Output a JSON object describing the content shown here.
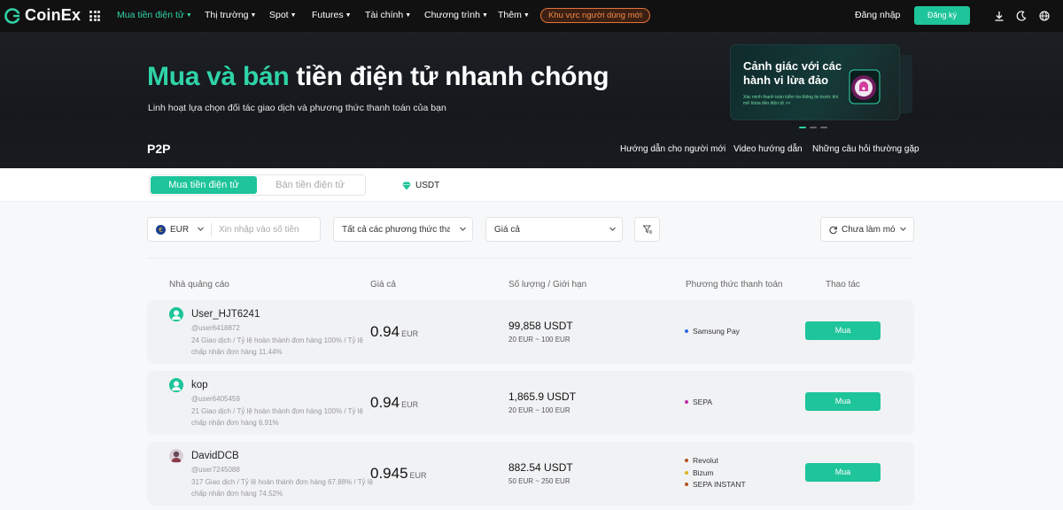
{
  "brand": {
    "name": "CoinEx",
    "accent": "#1ec49a"
  },
  "nav": {
    "items": [
      {
        "label": "Mua tiền điện tử",
        "active": true
      },
      {
        "label": "Thị trường"
      },
      {
        "label": "Spot"
      },
      {
        "label": "Futures"
      },
      {
        "label": "Tài chính"
      },
      {
        "label": "Chương trình"
      },
      {
        "label": "Thêm"
      }
    ],
    "new_user": "Khu vực người dùng mới",
    "login": "Đăng nhập",
    "signup": "Đăng ký",
    "icons": [
      "download-icon",
      "moon-icon",
      "globe-icon"
    ]
  },
  "hero": {
    "title_accent": "Mua và bán",
    "title_rest": " tiền điện tử nhanh chóng",
    "subtitle": "Linh hoạt lựa chọn đối tác giao dịch và phương thức thanh toán của bạn",
    "section": "P2P",
    "links": [
      "Hướng dẫn cho người mới",
      "Video hướng dẫn",
      "Những câu hỏi thường gặp"
    ],
    "banner": {
      "title": "Cảnh giác với các hành vi lừa đảo",
      "subtitle": "Xác minh thanh toán kiểm tra thông tin trước khi mở khóa tiền điện tử >>"
    }
  },
  "tabs": {
    "buy": "Mua tiền điện tử",
    "sell": "Bán tiền điện tử",
    "coin": "USDT"
  },
  "filters": {
    "currency": "EUR",
    "amount_placeholder": "Xin nhập vào số tiền",
    "payment": "Tất cả các phương thức thanh toán",
    "sort": "Giá cả",
    "status": "Chưa làm mới"
  },
  "table": {
    "headers": [
      "Nhà quảng cáo",
      "Giá cả",
      "Số lượng / Giới hạn",
      "Phương thức thanh toán",
      "Thao tác"
    ],
    "rows": [
      {
        "name": "User_HJT6241",
        "id": "@user6418872",
        "stats": "24 Giao dịch / Tỷ lệ hoàn thành đơn hàng 100% / Tỷ lệ chấp nhận đơn hàng 11.44%",
        "price": "0.94",
        "currency": "EUR",
        "qty": "99,858 USDT",
        "limit": "20 EUR ~ 100 EUR",
        "payments": [
          {
            "name": "Samsung Pay",
            "color": "#2d6be0"
          }
        ],
        "action": "Mua"
      },
      {
        "name": "kop",
        "id": "@user6405459",
        "stats": "21 Giao dịch / Tỷ lệ hoàn thành đơn hàng 100% / Tỷ lệ chấp nhận đơn hàng 6.91%",
        "price": "0.94",
        "currency": "EUR",
        "qty": "1,865.9 USDT",
        "limit": "20 EUR ~ 100 EUR",
        "payments": [
          {
            "name": "SEPA",
            "color": "#c02da8"
          }
        ],
        "action": "Mua"
      },
      {
        "name": "DavidDCB",
        "id": "@user7245088",
        "stats": "317 Giao dịch / Tỷ lệ hoàn thành đơn hàng 67.88% / Tỷ lệ chấp nhận đơn hàng 74.52%",
        "price": "0.945",
        "currency": "EUR",
        "qty": "882.54 USDT",
        "limit": "50 EUR ~ 250 EUR",
        "payments": [
          {
            "name": "Revolut",
            "color": "#b3541e"
          },
          {
            "name": "Bizum",
            "color": "#e0b11d"
          },
          {
            "name": "SEPA INSTANT",
            "color": "#b3541e"
          }
        ],
        "action": "Mua"
      }
    ]
  }
}
